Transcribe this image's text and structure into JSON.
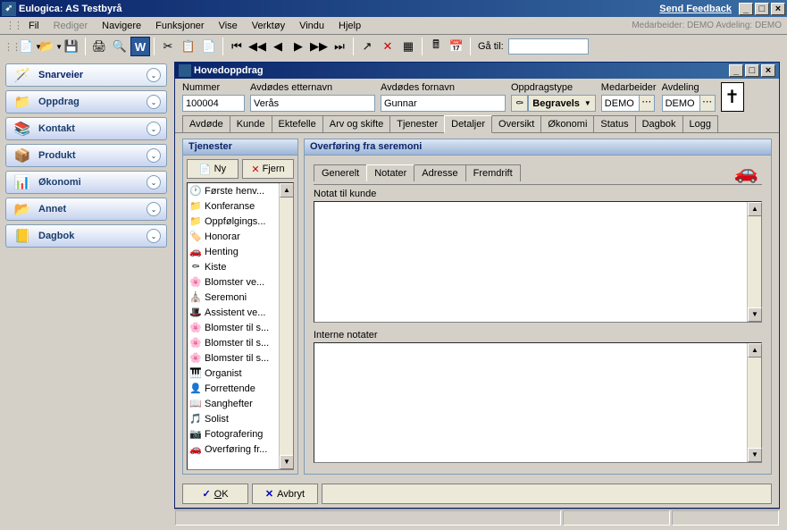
{
  "titlebar": {
    "title": "Eulogica: AS Testbyrå",
    "feedback": "Send Feedback"
  },
  "menubar": {
    "items": [
      "Fil",
      "Rediger",
      "Navigere",
      "Funksjoner",
      "Vise",
      "Verktøy",
      "Vindu",
      "Hjelp"
    ],
    "info": "Medarbeider: DEMO   Avdeling: DEMO"
  },
  "toolbar": {
    "goto_label": "Gå til:"
  },
  "sidebar": {
    "items": [
      {
        "label": "Snarveier",
        "icon": "🪄"
      },
      {
        "label": "Oppdrag",
        "icon": "📁"
      },
      {
        "label": "Kontakt",
        "icon": "📚"
      },
      {
        "label": "Produkt",
        "icon": "📦"
      },
      {
        "label": "Økonomi",
        "icon": "📊"
      },
      {
        "label": "Annet",
        "icon": "📂"
      },
      {
        "label": "Dagbok",
        "icon": "📒"
      }
    ]
  },
  "child": {
    "title": "Hovedoppdrag",
    "form": {
      "number_label": "Nummer",
      "number": "100004",
      "surname_label": "Avdødes etternavn",
      "surname": "Verås",
      "firstname_label": "Avdødes fornavn",
      "firstname": "Gunnar",
      "type_label": "Oppdragstype",
      "type": "Begravels",
      "staff_label": "Medarbeider",
      "staff": "DEMO",
      "dept_label": "Avdeling",
      "dept": "DEMO"
    },
    "tabs": [
      "Avdøde",
      "Kunde",
      "Ektefelle",
      "Arv og skifte",
      "Tjenester",
      "Detaljer",
      "Oversikt",
      "Økonomi",
      "Status",
      "Dagbok",
      "Logg"
    ],
    "active_tab": "Detaljer",
    "tjenester": {
      "title": "Tjenester",
      "ny": "Ny",
      "fjern": "Fjern",
      "items": [
        {
          "icon": "🕐",
          "label": "Første henv..."
        },
        {
          "icon": "📁",
          "label": "Konferanse"
        },
        {
          "icon": "📁",
          "label": "Oppfølgings..."
        },
        {
          "icon": "🏷️",
          "label": "Honorar"
        },
        {
          "icon": "🚗",
          "label": "Henting"
        },
        {
          "icon": "⚰",
          "label": "Kiste"
        },
        {
          "icon": "🌸",
          "label": "Blomster ve..."
        },
        {
          "icon": "⛪",
          "label": "Seremoni"
        },
        {
          "icon": "🎩",
          "label": "Assistent ve..."
        },
        {
          "icon": "🌸",
          "label": "Blomster til s..."
        },
        {
          "icon": "🌸",
          "label": "Blomster til s..."
        },
        {
          "icon": "🌸",
          "label": "Blomster til s..."
        },
        {
          "icon": "🎹",
          "label": "Organist"
        },
        {
          "icon": "👤",
          "label": "Forrettende"
        },
        {
          "icon": "📖",
          "label": "Sanghefter"
        },
        {
          "icon": "🎵",
          "label": "Solist"
        },
        {
          "icon": "📷",
          "label": "Fotografering"
        },
        {
          "icon": "🚗",
          "label": "Overføring fr..."
        }
      ]
    },
    "right_panel": {
      "title": "Overføring fra seremoni",
      "subtabs": [
        "Generelt",
        "Notater",
        "Adresse",
        "Fremdrift"
      ],
      "active_subtab": "Notater",
      "note1_label": "Notat til kunde",
      "note2_label": "Interne notater"
    },
    "buttons": {
      "ok": "OK",
      "cancel": "Avbryt"
    }
  }
}
